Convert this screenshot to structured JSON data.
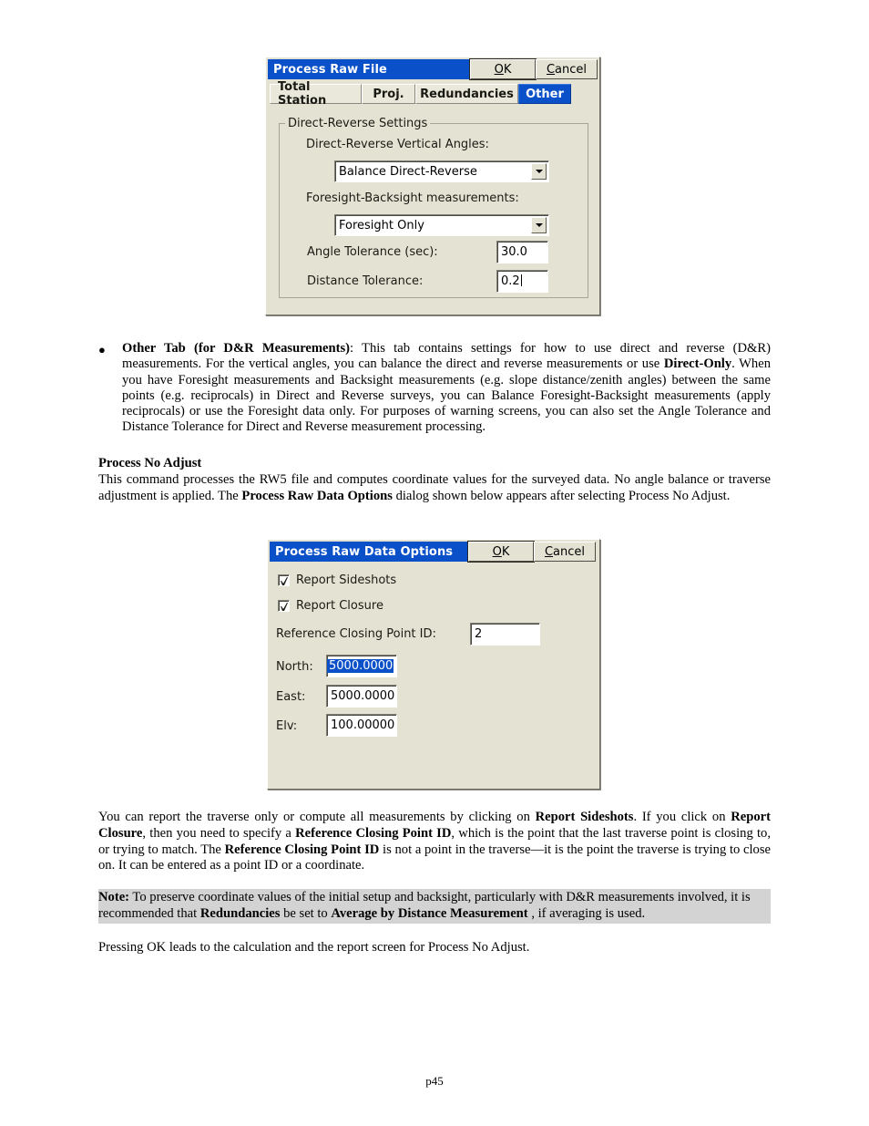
{
  "page": {
    "footer": "p45"
  },
  "dialog_process_raw_file": {
    "title": "Process Raw File",
    "ok_label_pre": "O",
    "ok_label_post": "K",
    "cancel_label_pre": "C",
    "cancel_label_post": "ancel",
    "tabs": [
      {
        "label": "Total Station",
        "active": false
      },
      {
        "label": "Proj.",
        "active": false
      },
      {
        "label": "Redundancies",
        "active": false
      },
      {
        "label": "Other",
        "active": true
      }
    ],
    "group_label": "Direct-Reverse Settings",
    "vertical_angles_label": "Direct-Reverse Vertical Angles:",
    "vertical_angles_value": "Balance Direct-Reverse",
    "foresight_backsight_label": "Foresight-Backsight measurements:",
    "foresight_backsight_value": "Foresight Only",
    "angle_tolerance_label": "Angle Tolerance (sec):",
    "angle_tolerance_value": "30.0",
    "distance_tolerance_label": "Distance Tolerance:",
    "distance_tolerance_value": "0.2"
  },
  "dialog_process_raw_data_options": {
    "title": "Process Raw Data Options",
    "ok_label_pre": "O",
    "ok_label_post": "K",
    "cancel_label_pre": "C",
    "cancel_label_post": "ancel",
    "report_sideshots_label": "Report Sideshots",
    "report_sideshots_checked": true,
    "report_closure_label": "Report Closure",
    "report_closure_checked": true,
    "reference_closing_point_label": "Reference Closing Point ID:",
    "reference_closing_point_value": "2",
    "north_label": "North:",
    "north_value": "5000.0000",
    "east_label": "East:",
    "east_value": "5000.0000",
    "elv_label": "Elv:",
    "elv_value": "100.00000"
  },
  "body": {
    "bullet_dot": "●",
    "bullet_other_tab_lead": "Other Tab (for D&R Measurements)",
    "bullet_other_tab_text_1": ":  This tab contains settings for how to use direct and reverse (D&R) measurements.  For the vertical angles, you can balance the direct and reverse measurements or use ",
    "bullet_other_tab_bold_2": "Direct-Only",
    "bullet_other_tab_text_3": ". When you have Foresight measurements and Backsight measurements (e.g. slope distance/zenith angles) between the same points (e.g. reciprocals) in Direct and Reverse surveys, you can Balance Foresight-Backsight measurements (apply reciprocals) or use the Foresight data only.  For purposes of warning screens, you can also set the Angle Tolerance and Distance Tolerance for Direct and Reverse measurement processing.",
    "process_no_adjust_heading": "Process No Adjust",
    "process_no_adjust_text_1": "This command processes the RW5 file and computes coordinate values for the surveyed data. No angle balance or traverse adjustment is applied. The ",
    "process_no_adjust_bold_2": "Process Raw Data Options",
    "process_no_adjust_text_3": " dialog shown below appears after selecting Process No Adjust.",
    "report_para_1": "You can report the traverse only or compute all measurements by clicking on ",
    "report_para_bold_2": "Report Sideshots",
    "report_para_3": ".  If you click on ",
    "report_para_bold_4": "Report Closure",
    "report_para_5": ", then you need to specify a ",
    "report_para_bold_6": "Reference Closing Point ID",
    "report_para_7": ", which is the point that the last traverse point is closing to, or trying to match.  The ",
    "report_para_bold_8": "Reference Closing Point ID",
    "report_para_9": " is not a point in the traverse—it is the point the traverse is trying to close on.  It can be entered as a point ID or a coordinate.",
    "note_label": "Note:",
    "note_text_1": "  To preserve coordinate values of the initial setup and backsight, particularly with D&R measurements involved, it is recommended that ",
    "note_bold_2": "Redundancies",
    "note_text_3": " be set to ",
    "note_bold_4": "Average by Distance Measurement",
    "note_text_5": " , if averaging is used.",
    "closing_para": "Pressing OK leads to the calculation and the report screen for Process No Adjust."
  }
}
